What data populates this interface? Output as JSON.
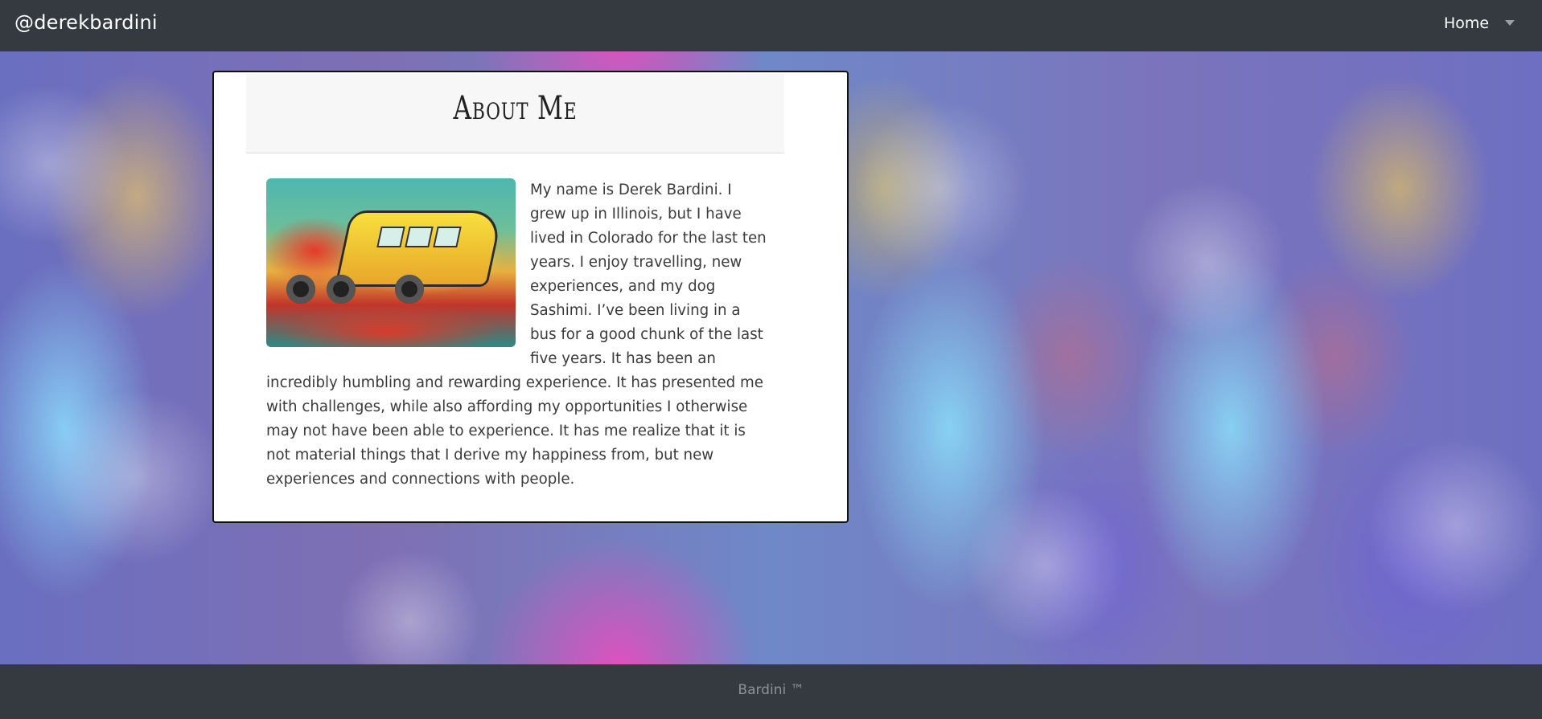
{
  "navbar": {
    "brand": "@derekbardini",
    "home_label": "Home"
  },
  "card": {
    "title": "About Me",
    "body": "My name is Derek Bardini. I grew up in Illinois, but I have lived in Colorado for the last ten years. I enjoy travelling, new experiences, and my dog Sashimi. I’ve been living in a bus for a good chunk of the last five years. It has been an incredibly humbling and rewarding experience. It has presented me with challenges, while also affording my opportunities I otherwise may not have been able to experience. It has me realize that it is not material things that I derive my happiness from, but new experiences and connections with people."
  },
  "footer": {
    "text": "Bardini ™"
  },
  "colors": {
    "navbar_bg": "#343a40",
    "card_bg": "#ffffff",
    "footer_text": "#8d939a"
  },
  "icons": {
    "dropdown": "caret-down-icon"
  }
}
